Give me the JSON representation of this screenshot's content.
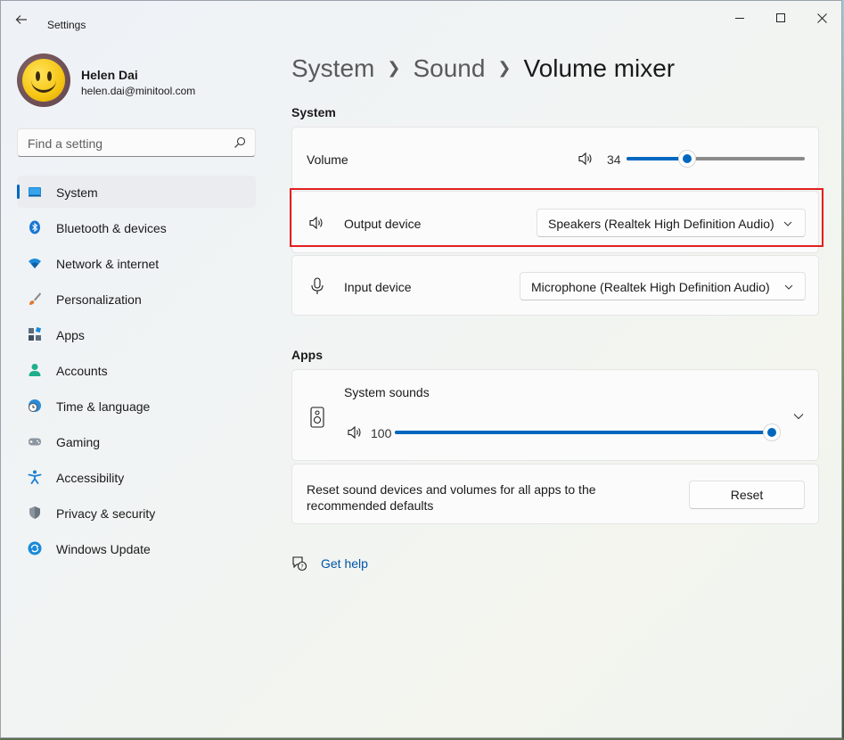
{
  "window": {
    "title": "Settings"
  },
  "profile": {
    "name": "Helen Dai",
    "email": "helen.dai@minitool.com"
  },
  "search": {
    "placeholder": "Find a setting"
  },
  "nav": {
    "items": [
      {
        "label": "System",
        "icon": "monitor-icon",
        "active": true
      },
      {
        "label": "Bluetooth & devices",
        "icon": "bluetooth-icon"
      },
      {
        "label": "Network & internet",
        "icon": "wifi-icon"
      },
      {
        "label": "Personalization",
        "icon": "brush-icon"
      },
      {
        "label": "Apps",
        "icon": "apps-icon"
      },
      {
        "label": "Accounts",
        "icon": "person-icon"
      },
      {
        "label": "Time & language",
        "icon": "globe-clock-icon"
      },
      {
        "label": "Gaming",
        "icon": "gamepad-icon"
      },
      {
        "label": "Accessibility",
        "icon": "accessibility-icon"
      },
      {
        "label": "Privacy & security",
        "icon": "shield-icon"
      },
      {
        "label": "Windows Update",
        "icon": "update-icon"
      }
    ]
  },
  "breadcrumb": {
    "items": [
      "System",
      "Sound",
      "Volume mixer"
    ]
  },
  "system_section": {
    "title": "System",
    "volume": {
      "label": "Volume",
      "value": "34",
      "level": 0.34
    },
    "output": {
      "label": "Output device",
      "selected": "Speakers (Realtek High Definition Audio)"
    },
    "input": {
      "label": "Input device",
      "selected": "Microphone (Realtek High Definition Audio)"
    }
  },
  "apps_section": {
    "title": "Apps",
    "system_sounds": {
      "label": "System sounds",
      "value": "100",
      "level": 1.0
    }
  },
  "reset": {
    "text_line1": "Reset sound devices and volumes for all apps to the",
    "text_line2": "recommended defaults",
    "button": "Reset"
  },
  "help": {
    "label": "Get help"
  },
  "colors": {
    "accent": "#0067c0",
    "highlight": "#e21f1f"
  }
}
